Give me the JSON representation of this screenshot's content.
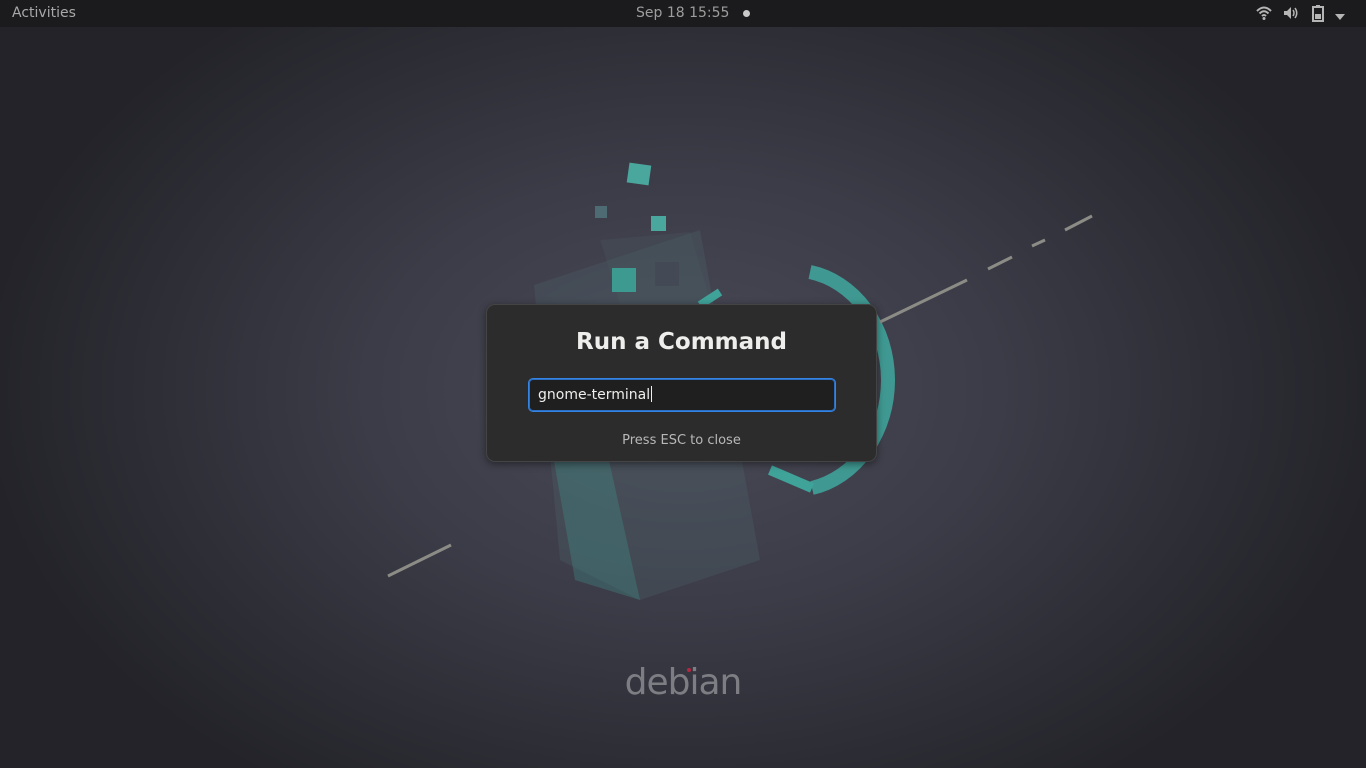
{
  "topbar": {
    "activities_label": "Activities",
    "clock": "Sep 18  15:55",
    "tray_icons": [
      "wifi-icon",
      "volume-icon",
      "battery-icon",
      "system-menu-arrow-icon"
    ]
  },
  "dialog": {
    "title": "Run a Command",
    "command_value": "gnome-terminal",
    "hint": "Press ESC to close",
    "focus_color": "#3584e4"
  },
  "wallpaper": {
    "brand_text": "debian",
    "accent_color": "#3fa39a"
  }
}
